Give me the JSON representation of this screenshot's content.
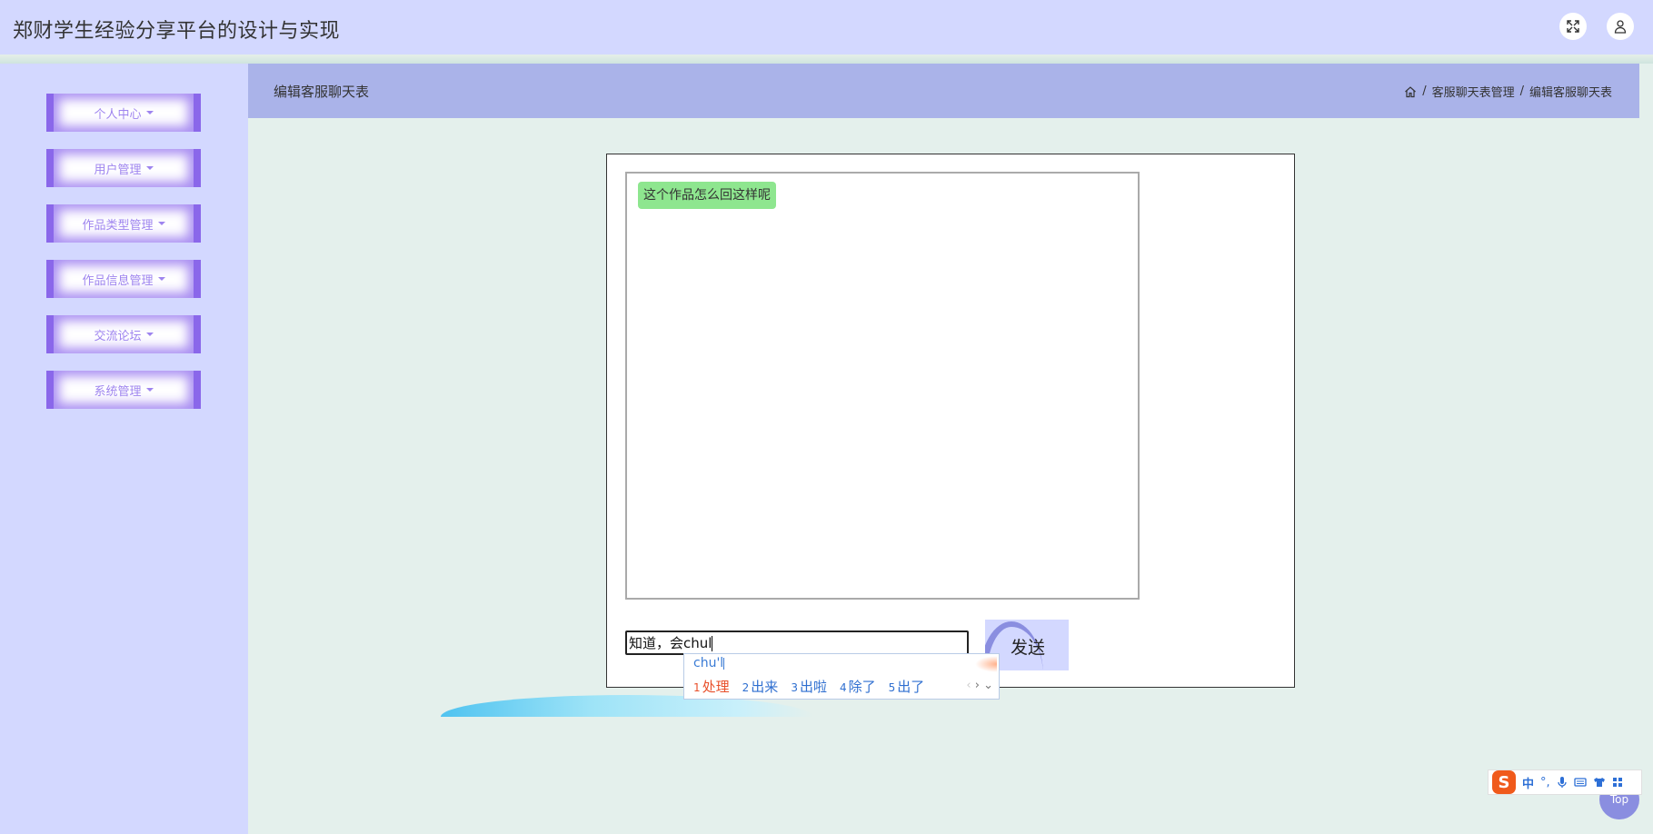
{
  "app": {
    "title": "郑财学生经验分享平台的设计与实现"
  },
  "header": {
    "fullscreen_icon": "fullscreen-icon",
    "user_icon": "user-icon"
  },
  "sidebar": {
    "items": [
      {
        "label": "个人中心"
      },
      {
        "label": "用户管理"
      },
      {
        "label": "作品类型管理"
      },
      {
        "label": "作品信息管理"
      },
      {
        "label": "交流论坛"
      },
      {
        "label": "系统管理"
      }
    ]
  },
  "page": {
    "title": "编辑客服聊天表",
    "breadcrumb": {
      "home_icon": "home-icon",
      "sep": "/",
      "parent": "客服聊天表管理",
      "current": "编辑客服聊天表"
    }
  },
  "chat": {
    "messages": [
      {
        "text": "这个作品怎么回这样呢",
        "color": "#8ee68f"
      }
    ],
    "input_value": "知道，会chul",
    "send_label": "发送"
  },
  "ime": {
    "composition": "chu'l",
    "candidates": [
      {
        "n": "1",
        "text": "处理"
      },
      {
        "n": "2",
        "text": "出来"
      },
      {
        "n": "3",
        "text": "出啦"
      },
      {
        "n": "4",
        "text": "除了"
      },
      {
        "n": "5",
        "text": "出了"
      }
    ],
    "toolbar": {
      "logo": "S",
      "mode": "中",
      "punct": "°,"
    }
  },
  "back_to_top": {
    "label": "Top"
  },
  "colors": {
    "accent": "#8a67ea",
    "header": "#d3d8ff",
    "page_header": "#aab3e9",
    "background": "#e4f0ec"
  }
}
